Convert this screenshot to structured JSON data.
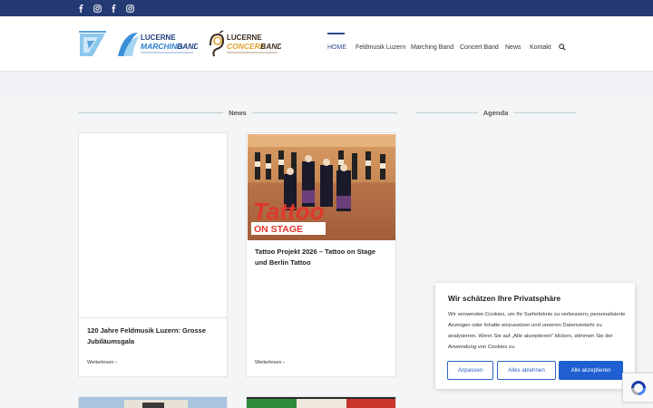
{
  "social": [
    "facebook-icon",
    "instagram-icon",
    "facebook-icon",
    "instagram-icon"
  ],
  "logos": {
    "marching": {
      "line1": "LUCERNE",
      "line2": "MARCHING",
      "line3": "BAND"
    },
    "concert": {
      "line1": "LUCERNE",
      "line2": "CONCERT",
      "line3": "BAND"
    }
  },
  "nav": {
    "items": [
      "HOME",
      "Feldmusik Luzern",
      "Marching Band",
      "Concert Band",
      "News",
      "Kontakt"
    ]
  },
  "sections": {
    "news": "News",
    "agenda": "Agenda"
  },
  "posts": [
    {
      "title": "120 Jahre Feldmusik Luzern: Grosse Jubiläumsgala",
      "more": "Weiterlesen"
    },
    {
      "title": "Tattoo Projekt 2026 – Tattoo on Stage und Berlin Tattoo",
      "more": "Weiterlesen",
      "image_text": {
        "line1": "Tattoo",
        "line2": "ON STAGE"
      }
    }
  ],
  "cookie": {
    "title": "Wir schätzen Ihre Privatsphäre",
    "text": "Wir verwenden Cookies, um Ihr Surferlebnis zu verbessern, personalisierte Anzeigen oder Inhalte einzusetzen und unseren Datenverkehr zu analysieren. Wenn Sie auf „Alle akzeptieren\" klicken, stimmen Sie der Anwendung von Cookies zu.",
    "buttons": {
      "customize": "Anpassen",
      "reject": "Alles ablehnen",
      "accept": "Alle akzeptieren"
    }
  },
  "colors": {
    "topbar": "#233a73",
    "accent": "#2f4d8f",
    "cookie_button": "#1f5fd1"
  }
}
